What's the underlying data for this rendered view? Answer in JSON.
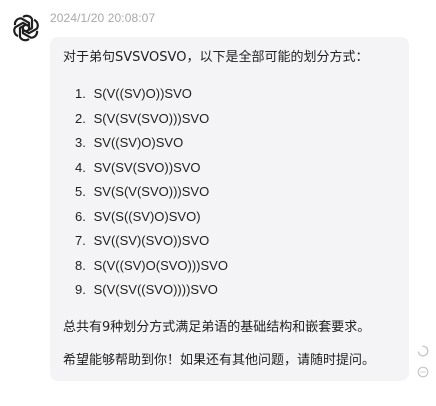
{
  "message": {
    "avatar_icon": "openai-logo-icon",
    "timestamp": "2024/1/20 20:08:07",
    "intro": "对于弟句SVSVOSVO，以下是全部可能的划分方式：",
    "solutions": [
      {
        "number": "1.",
        "text": "S(V((SV)O))SVO"
      },
      {
        "number": "2.",
        "text": "S(V(SV(SVO)))SVO"
      },
      {
        "number": "3.",
        "text": "SV((SV)O)SVO"
      },
      {
        "number": "4.",
        "text": "SV(SV(SVO))SVO"
      },
      {
        "number": "5.",
        "text": "SV(S(V(SVO)))SVO"
      },
      {
        "number": "6.",
        "text": "SV(S((SV)O)SVO)"
      },
      {
        "number": "7.",
        "text": "SV((SV)(SVO))SVO"
      },
      {
        "number": "8.",
        "text": "S(V((SV)O(SVO)))SVO"
      },
      {
        "number": "9.",
        "text": "S(V(SV((SVO))))SVO"
      }
    ],
    "summary": "总共有9种划分方式满足弟语的基础结构和嵌套要求。",
    "closing": "希望能够帮助到你！如果还有其他问题，请随时提问。"
  },
  "side_icons": [
    "loading-circle-icon",
    "more-circle-icon"
  ],
  "colors": {
    "bubble_background": "#f4f4f6",
    "text": "#1f1f1f",
    "timestamp": "#a8a8a8"
  }
}
